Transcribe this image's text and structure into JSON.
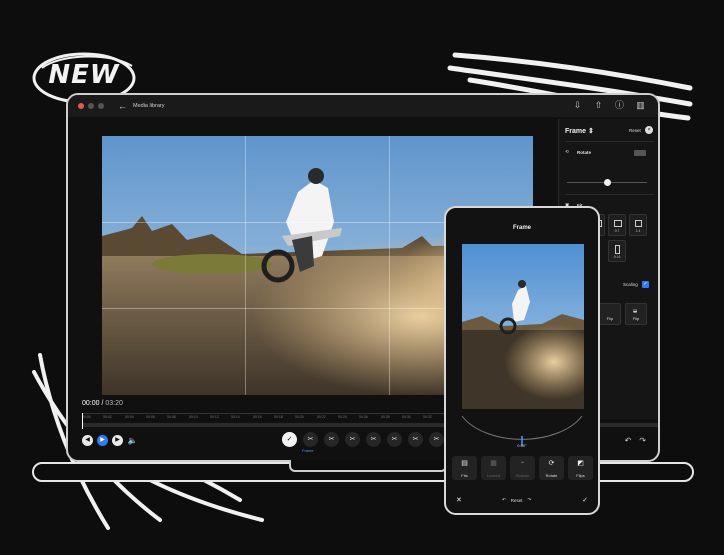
{
  "badge": {
    "text": "NEW"
  },
  "laptop": {
    "window_title": "Media library",
    "time": {
      "current": "00:00",
      "separator": " / ",
      "total": "03:20"
    },
    "ruler_labels": [
      "00:00",
      "00:02",
      "00:04",
      "00:06",
      "00:08",
      "00:10",
      "00:12",
      "00:14",
      "00:16",
      "00:18",
      "00:20",
      "00:22",
      "00:24",
      "00:26",
      "00:28",
      "00:30",
      "00:32",
      "00:34",
      "00:36",
      "00:38",
      "00:40",
      "00:42",
      "00:44",
      "00:46",
      "00:48",
      "00:50",
      "00:52"
    ],
    "active_tool_label": "Frame",
    "panel": {
      "title": "Frame",
      "title_caret": "⇕",
      "reset_label": "Reset",
      "rotate_label": "Rotate",
      "fit_label": "Fit",
      "aspect_ratios": [
        "",
        "",
        "9:7",
        "1:1",
        "9:16"
      ],
      "scaling_label": "Scaling",
      "flip_label": "Flip",
      "flip_label_2": "Flip"
    }
  },
  "phone": {
    "title": "Frame",
    "angle": "0.00°",
    "tools": [
      {
        "label": "Fits",
        "icon": "fit-icon",
        "enabled": true
      },
      {
        "label": "Locked",
        "icon": "lock-icon",
        "enabled": false
      },
      {
        "label": "Horizon",
        "icon": "horizon-icon",
        "enabled": false
      },
      {
        "label": "Rotate",
        "icon": "rotate-icon",
        "enabled": true
      },
      {
        "label": "Flips",
        "icon": "flip-icon",
        "enabled": true
      }
    ],
    "reset_label": "Reset"
  },
  "colors": {
    "accent": "#2f7bf5",
    "background": "#0d0d0d",
    "panel": "#151515"
  }
}
